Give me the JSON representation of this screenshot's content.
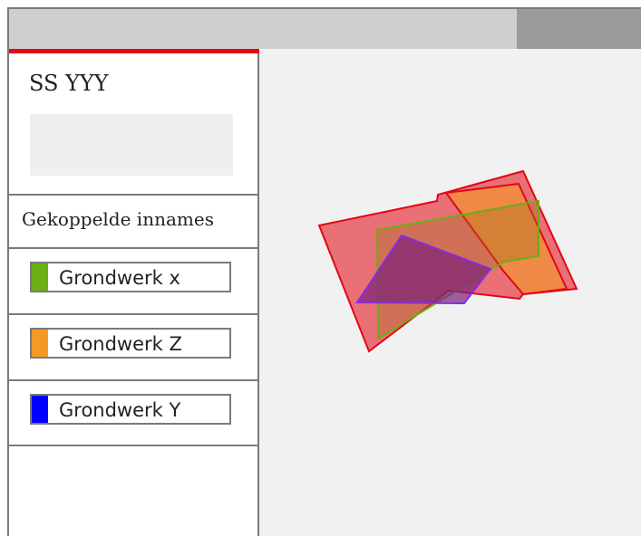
{
  "panel": {
    "title": "SS YYY",
    "accent_color": "#e30613",
    "section_title": "Gekoppelde innames",
    "items": [
      {
        "label": "Grondwerk x",
        "color": "#6aaf13"
      },
      {
        "label": "Grondwerk Z",
        "color": "#f39a26"
      },
      {
        "label": "Grondwerk Y",
        "color": "#0000ff"
      }
    ]
  },
  "map": {
    "shape_colors": [
      "#e30613",
      "#f39a26",
      "#6aaf13",
      "#8a2be2"
    ]
  }
}
